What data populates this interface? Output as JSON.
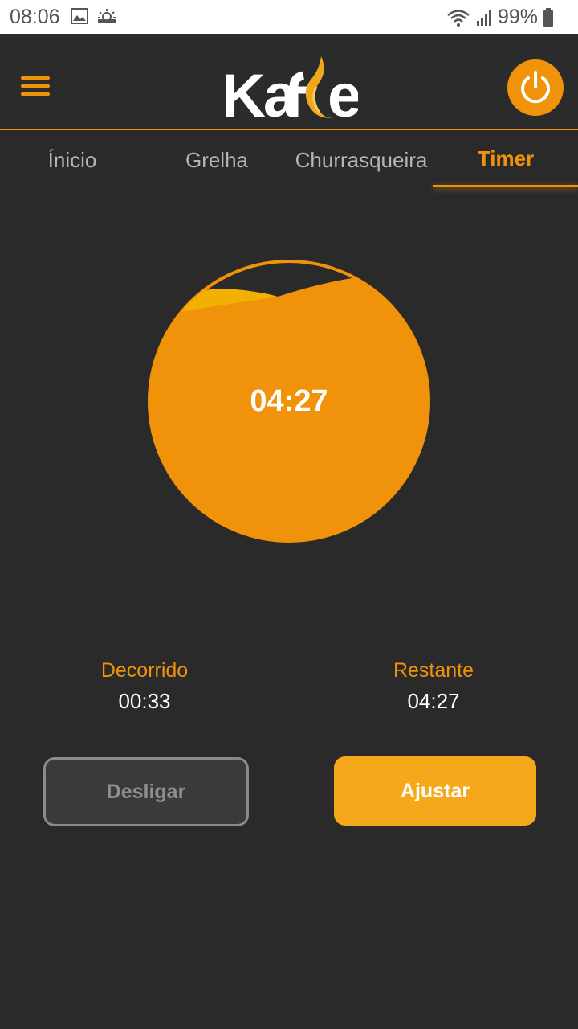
{
  "status_bar": {
    "time": "08:06",
    "battery": "99%",
    "icons": [
      "image-icon",
      "weather-icon",
      "wifi-icon",
      "signal-icon",
      "battery-icon"
    ]
  },
  "app_bar": {
    "logo": "Kafer",
    "menu_icon": "hamburger-menu-icon",
    "power_icon": "power-icon",
    "accent_color": "#f0920a"
  },
  "tabs": [
    {
      "label": "Ínicio",
      "active": false
    },
    {
      "label": "Grelha",
      "active": false
    },
    {
      "label": "Churrasqueira",
      "active": false
    },
    {
      "label": "Timer",
      "active": true
    }
  ],
  "timer": {
    "display": "04:27",
    "fill_fraction": 0.89
  },
  "stats": {
    "elapsed_label": "Decorrido",
    "elapsed_value": "00:33",
    "remaining_label": "Restante",
    "remaining_value": "04:27"
  },
  "buttons": {
    "off_label": "Desligar",
    "adjust_label": "Ajustar"
  }
}
